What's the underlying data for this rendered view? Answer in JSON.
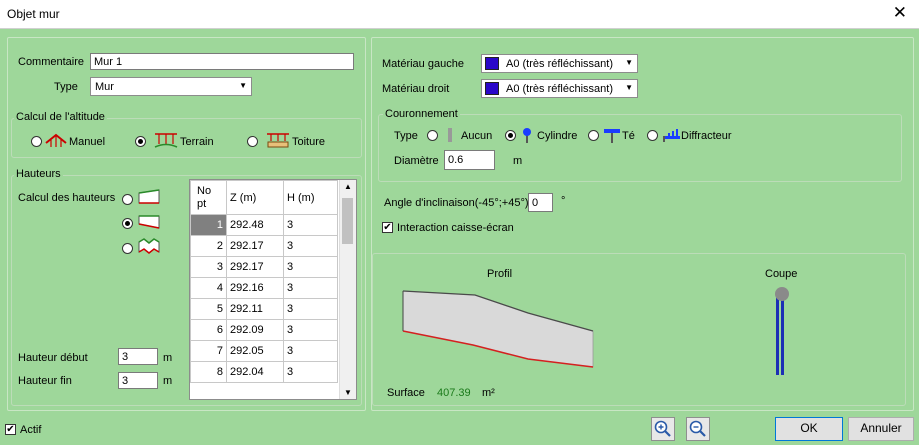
{
  "window": {
    "title": "Objet mur"
  },
  "general": {
    "comment_label": "Commentaire",
    "comment_value": "Mur 1",
    "type_label": "Type",
    "type_value": "Mur"
  },
  "altitude": {
    "legend": "Calcul de l'altitude",
    "manual": "Manuel",
    "terrain": "Terrain",
    "roof": "Toiture",
    "selected": "terrain"
  },
  "heights": {
    "legend": "Hauteurs",
    "calc_label": "Calcul des hauteurs",
    "start_label": "Hauteur début",
    "start_value": "3",
    "start_unit": "m",
    "end_label": "Hauteur fin",
    "end_value": "3",
    "end_unit": "m",
    "table": {
      "col_no_1": "No",
      "col_no_2": "pt",
      "col_z": "Z (m)",
      "col_h": "H (m)",
      "rows": [
        {
          "no": "1",
          "z": "292.48",
          "h": "3"
        },
        {
          "no": "2",
          "z": "292.17",
          "h": "3"
        },
        {
          "no": "3",
          "z": "292.17",
          "h": "3"
        },
        {
          "no": "4",
          "z": "292.16",
          "h": "3"
        },
        {
          "no": "5",
          "z": "292.11",
          "h": "3"
        },
        {
          "no": "6",
          "z": "292.09",
          "h": "3"
        },
        {
          "no": "7",
          "z": "292.05",
          "h": "3"
        },
        {
          "no": "8",
          "z": "292.04",
          "h": "3"
        }
      ]
    }
  },
  "materials": {
    "left_label": "Matériau gauche",
    "left_value": "A0 (très réfléchissant)",
    "right_label": "Matériau droit",
    "right_value": "A0 (très réfléchissant)",
    "swatch_color": "#2a07c9"
  },
  "crown": {
    "legend": "Couronnement",
    "type_label": "Type",
    "none": "Aucun",
    "cylinder": "Cylindre",
    "tee": "Té",
    "diffractor": "Diffracteur",
    "selected": "cylinder",
    "diameter_label": "Diamètre",
    "diameter_value": "0.6",
    "diameter_unit": "m"
  },
  "angle": {
    "label": "Angle d'inclinaison(-45°;+45°)",
    "value": "0",
    "unit": "°"
  },
  "interaction": {
    "label": "Interaction caisse-écran",
    "checked": true
  },
  "preview": {
    "profile_label": "Profil",
    "section_label": "Coupe",
    "surface_label": "Surface",
    "surface_value": "407.39",
    "surface_unit": "m²"
  },
  "footer": {
    "active_label": "Actif",
    "active_checked": true,
    "ok": "OK",
    "cancel": "Annuler"
  }
}
